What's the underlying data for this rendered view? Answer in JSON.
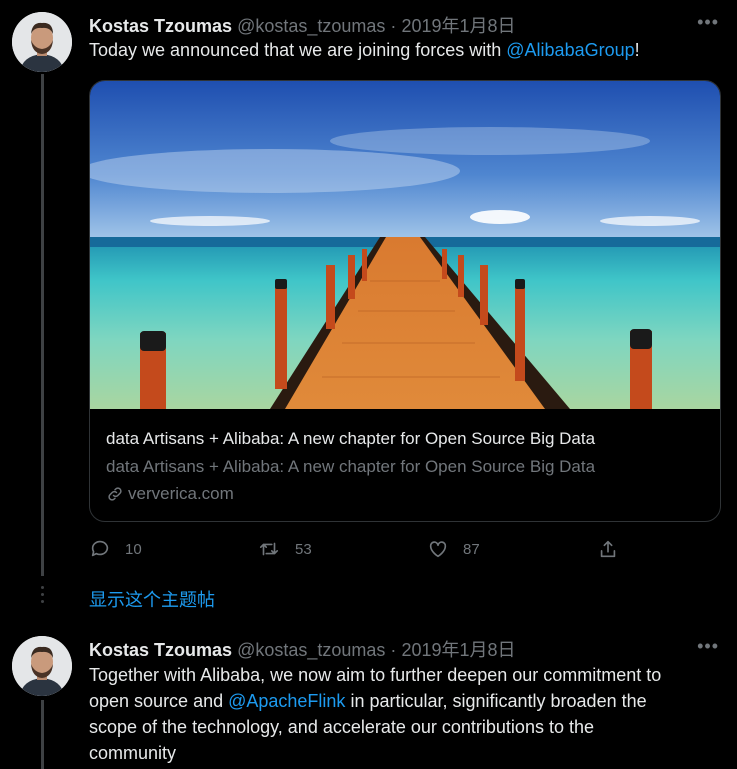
{
  "tweet1": {
    "name": "Kostas Tzoumas",
    "handle": "@kostas_tzoumas",
    "separator": "·",
    "date": "2019年1月8日",
    "more": "•••",
    "text_before": "Today we announced that we are joining forces with ",
    "mention": "@AlibabaGroup",
    "text_after": "!",
    "card": {
      "title": "data Artisans + Alibaba: A new chapter for Open Source Big Data",
      "description": "data Artisans + Alibaba: A new chapter for Open Source Big Data",
      "domain": "ververica.com"
    },
    "actions": {
      "reply_count": "10",
      "retweet_count": "53",
      "like_count": "87"
    }
  },
  "show_thread": "显示这个主题帖",
  "tweet2": {
    "name": "Kostas Tzoumas",
    "handle": "@kostas_tzoumas",
    "separator": "·",
    "date": "2019年1月8日",
    "more": "•••",
    "line1": "Together with Alibaba, we now aim to further deepen our commitment to",
    "line2_before": "open source and ",
    "line2_mention": "@ApacheFlink",
    "line2_after": " in particular, significantly broaden the",
    "line3": "scope of the technology, and accelerate our contributions to the",
    "line4": "community"
  },
  "colors": {
    "background": "#000000",
    "text": "#e7e9ea",
    "secondary": "#71767b",
    "link": "#1d9bf0",
    "border": "#2f3336"
  },
  "icons": [
    "reply-icon",
    "retweet-icon",
    "like-icon",
    "share-icon",
    "link-icon",
    "more-icon"
  ]
}
